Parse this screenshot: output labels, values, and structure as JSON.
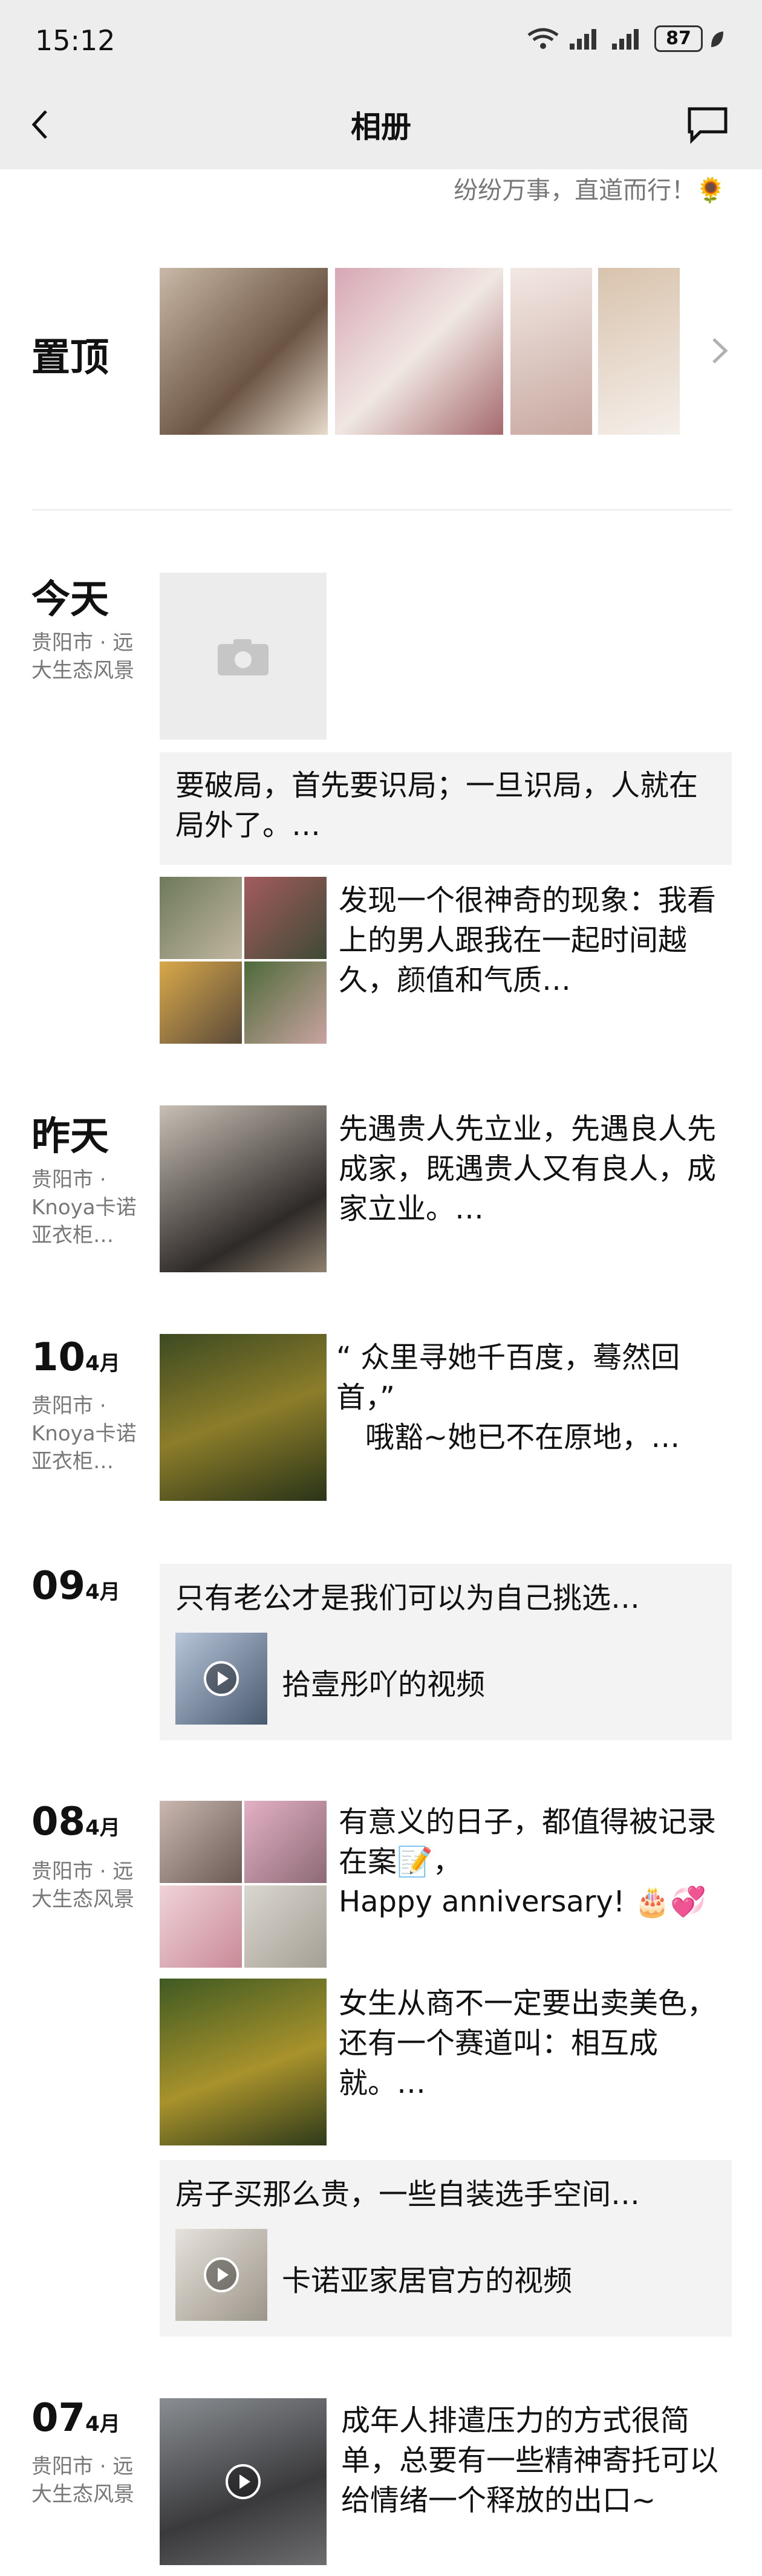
{
  "status": {
    "time": "15:12",
    "battery": "87"
  },
  "nav": {
    "title": "相册"
  },
  "signature": "纷纷万事，直道而行！🌻",
  "pinned": {
    "title": "置顶"
  },
  "sections": [
    {
      "day": "今天",
      "location": "贵阳市 · 远大生态风景"
    },
    {
      "day": "昨天",
      "location": "贵阳市 · Knoya卡诺亚衣柜…"
    },
    {
      "day": "10",
      "month": "4月",
      "location": "贵阳市 · Knoya卡诺亚衣柜…"
    },
    {
      "day": "09",
      "month": "4月"
    },
    {
      "day": "08",
      "month": "4月",
      "location": "贵阳市 · 远大生态风景"
    },
    {
      "day": "07",
      "month": "4月",
      "location": "贵阳市 · 远大生态风景"
    }
  ],
  "posts": {
    "today_text": "要破局，首先要识局；一旦识局，人就在局外了。…",
    "today_photo_text": "发现一个很神奇的现象：我看上的男人跟我在一起时间越久，颜值和气质…",
    "yesterday_text": "先遇贵人先立业，先遇良人先成家，既遇贵人又有良人，成家立业。…",
    "apr10_text_line1": "“ 众里寻她千百度，蓦然回首，”",
    "apr10_text_line2": "哦豁~她已不在原地，…",
    "apr09_text": "只有老公才是我们可以为自己挑选…",
    "apr09_video": "拾壹彤吖的视频",
    "apr08_text1_a": "有意义的日子，都值得被记录在案📝，",
    "apr08_text1_b": "Happy anniversary! 🎂💞",
    "apr08_text2": "女生从商不一定要出卖美色，还有一个赛道叫：相互成就。…",
    "apr08_text3": "房子买那么贵，一些自装选手空间…",
    "apr08_video": "卡诺亚家居官方的视频",
    "apr07_text": "成年人排遣压力的方式很简单，总要有一些精神寄托可以给情绪一个释放的出口~"
  },
  "colors": {
    "topbar": "#ededed",
    "card": "#f3f3f3",
    "muted": "#777777"
  }
}
